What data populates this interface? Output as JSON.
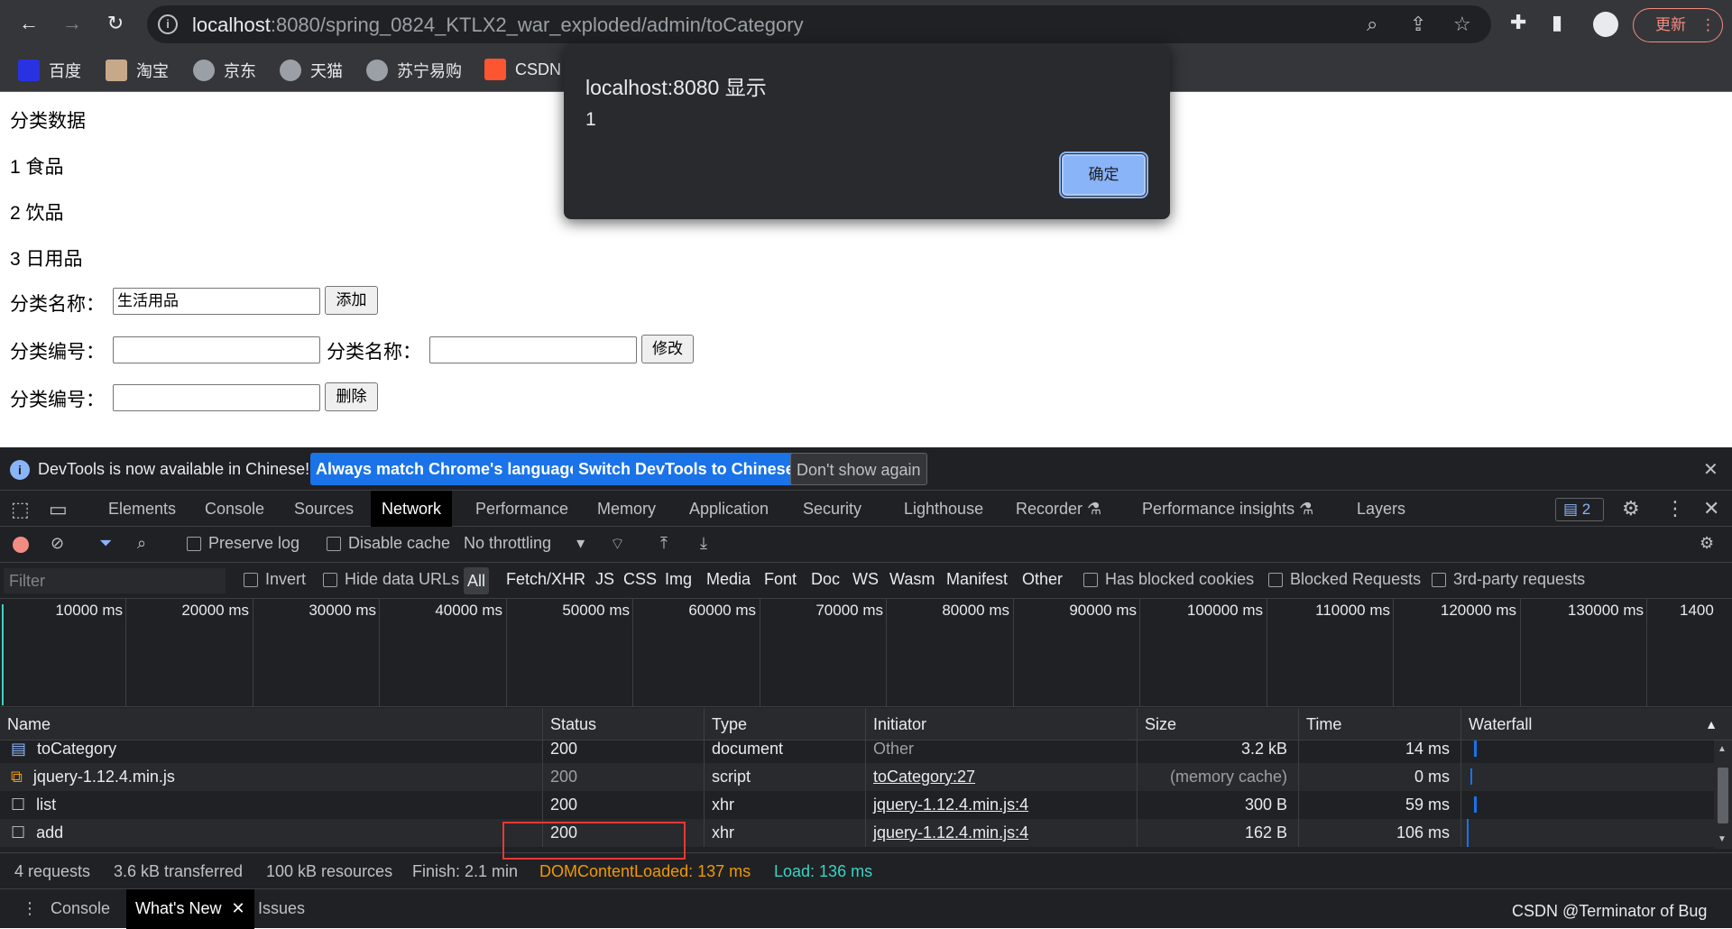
{
  "browser": {
    "url_host": "localhost",
    "url_path": ":8080/spring_0824_KTLX2_war_exploded/admin/toCategory",
    "update_label": "更新"
  },
  "bookmarks": [
    "百度",
    "淘宝",
    "京东",
    "天猫",
    "苏宁易购",
    "CSDN"
  ],
  "page": {
    "heading": "分类数据",
    "categories": [
      "1 食品",
      "2 饮品",
      "3 日用品"
    ],
    "add_label": "分类名称：",
    "add_value": "生活用品",
    "add_button": "添加",
    "update_id_label": "分类编号：",
    "update_name_label": "分类名称：",
    "update_button": "修改",
    "delete_id_label": "分类编号：",
    "delete_button": "删除"
  },
  "dialog": {
    "title": "localhost:8080 显示",
    "message": "1",
    "ok_label": "确定"
  },
  "devtools": {
    "lang_notice": "DevTools is now available in Chinese!",
    "lang_btn_match": "Always match Chrome's language",
    "lang_btn_switch": "Switch DevTools to Chinese",
    "lang_btn_dismiss": "Don't show again",
    "tabs": [
      "Elements",
      "Console",
      "Sources",
      "Network",
      "Performance",
      "Memory",
      "Application",
      "Security",
      "Lighthouse",
      "Recorder",
      "Performance insights",
      "Layers"
    ],
    "active_tab": "Network",
    "message_count": "2",
    "toolbar": {
      "preserve_log": "Preserve log",
      "disable_cache": "Disable cache",
      "throttling": "No throttling"
    },
    "filter": {
      "placeholder": "Filter",
      "invert": "Invert",
      "hide_data_urls": "Hide data URLs",
      "types": [
        "All",
        "Fetch/XHR",
        "JS",
        "CSS",
        "Img",
        "Media",
        "Font",
        "Doc",
        "WS",
        "Wasm",
        "Manifest",
        "Other"
      ],
      "has_blocked_cookies": "Has blocked cookies",
      "blocked_requests": "Blocked Requests",
      "third_party": "3rd-party requests"
    },
    "overview_ticks": [
      "10000 ms",
      "20000 ms",
      "30000 ms",
      "40000 ms",
      "50000 ms",
      "60000 ms",
      "70000 ms",
      "80000 ms",
      "90000 ms",
      "100000 ms",
      "110000 ms",
      "120000 ms",
      "130000 ms",
      "1400"
    ],
    "columns": [
      "Name",
      "Status",
      "Type",
      "Initiator",
      "Size",
      "Time",
      "Waterfall"
    ],
    "requests": [
      {
        "name": "toCategory",
        "status": "200",
        "type": "document",
        "initiator": "Other",
        "size": "3.2 kB",
        "time": "14 ms"
      },
      {
        "name": "jquery-1.12.4.min.js",
        "status": "200",
        "type": "script",
        "initiator": "toCategory:27",
        "size": "(memory cache)",
        "time": "0 ms"
      },
      {
        "name": "list",
        "status": "200",
        "type": "xhr",
        "initiator": "jquery-1.12.4.min.js:4",
        "size": "300 B",
        "time": "59 ms"
      },
      {
        "name": "add",
        "status": "200",
        "type": "xhr",
        "initiator": "jquery-1.12.4.min.js:4",
        "size": "162 B",
        "time": "106 ms"
      }
    ],
    "summary": {
      "requests": "4 requests",
      "transferred": "3.6 kB transferred",
      "resources": "100 kB resources",
      "finish": "Finish: 2.1 min",
      "dom_loaded": "DOMContentLoaded: 137 ms",
      "load": "Load: 136 ms"
    },
    "drawer_tabs": [
      "Console",
      "What's New",
      "Issues"
    ]
  },
  "watermark": "CSDN @Terminator of Bug",
  "colors": {
    "accent": "#1a73e8",
    "dom_loaded": "#f29900",
    "load": "#3ad4c4",
    "highlight": "#e53935"
  }
}
